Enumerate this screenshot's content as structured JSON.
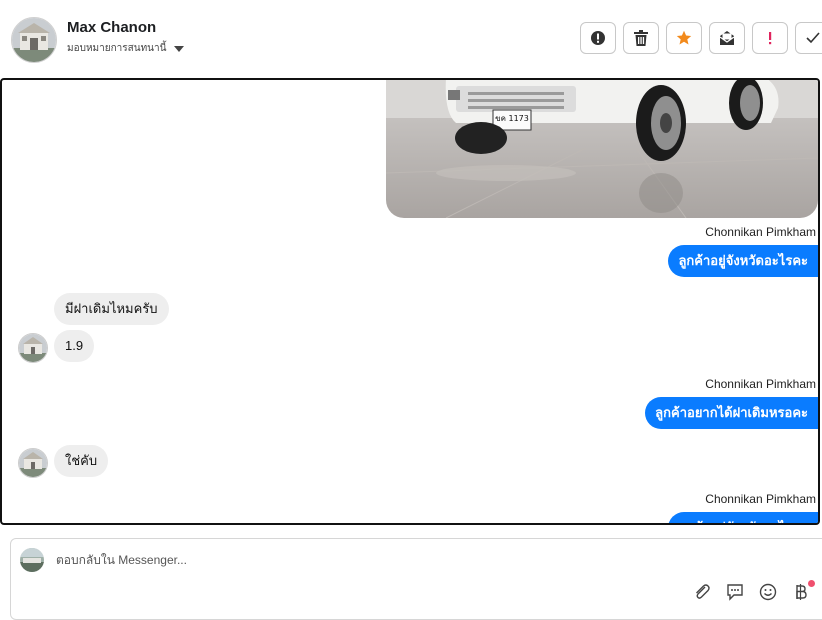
{
  "header": {
    "contact_name": "Max Chanon",
    "assign_label": "มอบหมายการสนทนานี้"
  },
  "actions": [
    {
      "name": "spam",
      "icon": "exclamation-circle-icon"
    },
    {
      "name": "delete",
      "icon": "trash-icon"
    },
    {
      "name": "star",
      "icon": "star-icon",
      "color": "#f28a1c"
    },
    {
      "name": "mark-unread",
      "icon": "envelope-open-icon"
    },
    {
      "name": "important",
      "icon": "exclamation-icon",
      "color": "#e0245e"
    },
    {
      "name": "done",
      "icon": "check-icon"
    }
  ],
  "messages": {
    "image": {
      "plate_text": "ขค 1173"
    },
    "sender_1": "Chonnikan Pimkham",
    "out_1": "ลูกค้าอยู่จังหวัดอะไรคะ",
    "in_1": "มีฝาเดิมไหมครับ",
    "in_2": "1.9",
    "sender_2": "Chonnikan Pimkham",
    "out_2": "ลูกค้าอยากได้ฝาเดิมหรอคะ",
    "in_3": "ใช่คับ",
    "sender_3": "Chonnikan Pimkham",
    "out_3": "ลูกค้าอยู่จังหวัดอะไรคะ"
  },
  "composer": {
    "placeholder": "ตอบกลับใน Messenger...",
    "tools": [
      "paperclip-icon",
      "chat-bubble-icon",
      "smiley-icon",
      "baht-icon"
    ]
  },
  "colors": {
    "outgoing_bubble": "#0a7cff",
    "incoming_bubble": "#eeeeee",
    "star": "#f28a1c",
    "important": "#e0245e"
  }
}
